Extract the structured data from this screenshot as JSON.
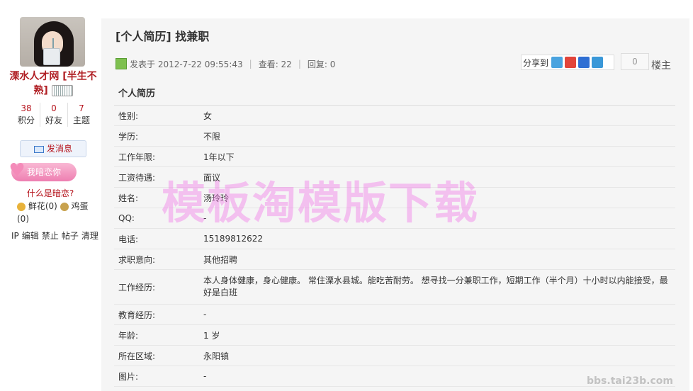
{
  "sidebar": {
    "username": "溧水人才网 [半生不熟]",
    "stats": [
      {
        "num": "38",
        "label": "积分"
      },
      {
        "num": "0",
        "label": "好友"
      },
      {
        "num": "7",
        "label": "主题"
      }
    ],
    "send_message": "发消息",
    "crush_button": "我暗恋你",
    "crush_question": "什么是暗恋?",
    "flowers": "鲜花(0)",
    "eggs": "鸡蛋",
    "eggs_count": "(0)",
    "admin_actions": [
      "IP",
      "编辑",
      "禁止",
      "帖子",
      "清理"
    ]
  },
  "thread": {
    "title": "[个人简历] 找兼职",
    "posted": "发表于 2012-7-22 09:55:43",
    "views": "查看: 22",
    "replies": "回复: 0",
    "share_label": "分享到",
    "share_count": "0",
    "floor": "楼主"
  },
  "resume": {
    "heading": "个人简历",
    "rows": [
      {
        "k": "性别:",
        "v": "女"
      },
      {
        "k": "学历:",
        "v": "不限"
      },
      {
        "k": "工作年限:",
        "v": "1年以下"
      },
      {
        "k": "工资待遇:",
        "v": "面议"
      },
      {
        "k": "姓名:",
        "v": "汤玲玲"
      },
      {
        "k": "QQ:",
        "v": "-"
      },
      {
        "k": "电话:",
        "v": "15189812622"
      },
      {
        "k": "求职意向:",
        "v": "其他招聘"
      },
      {
        "k": "工作经历:",
        "v": "本人身体健康，身心健康。 常住溧水县城。能吃苦耐劳。 想寻找一分兼职工作，短期工作（半个月）十小时以内能接受，最好是白班"
      },
      {
        "k": "教育经历:",
        "v": "-"
      },
      {
        "k": "年龄:",
        "v": "1 岁"
      },
      {
        "k": "所在区域:",
        "v": "永阳镇"
      },
      {
        "k": "图片:",
        "v": "-"
      }
    ]
  },
  "watermark": "模板淘模版下载",
  "corner_watermark": "bbs.tai23b.com",
  "colors": {
    "accent_red": "#b5121b",
    "pink": "#ee7fb1"
  }
}
